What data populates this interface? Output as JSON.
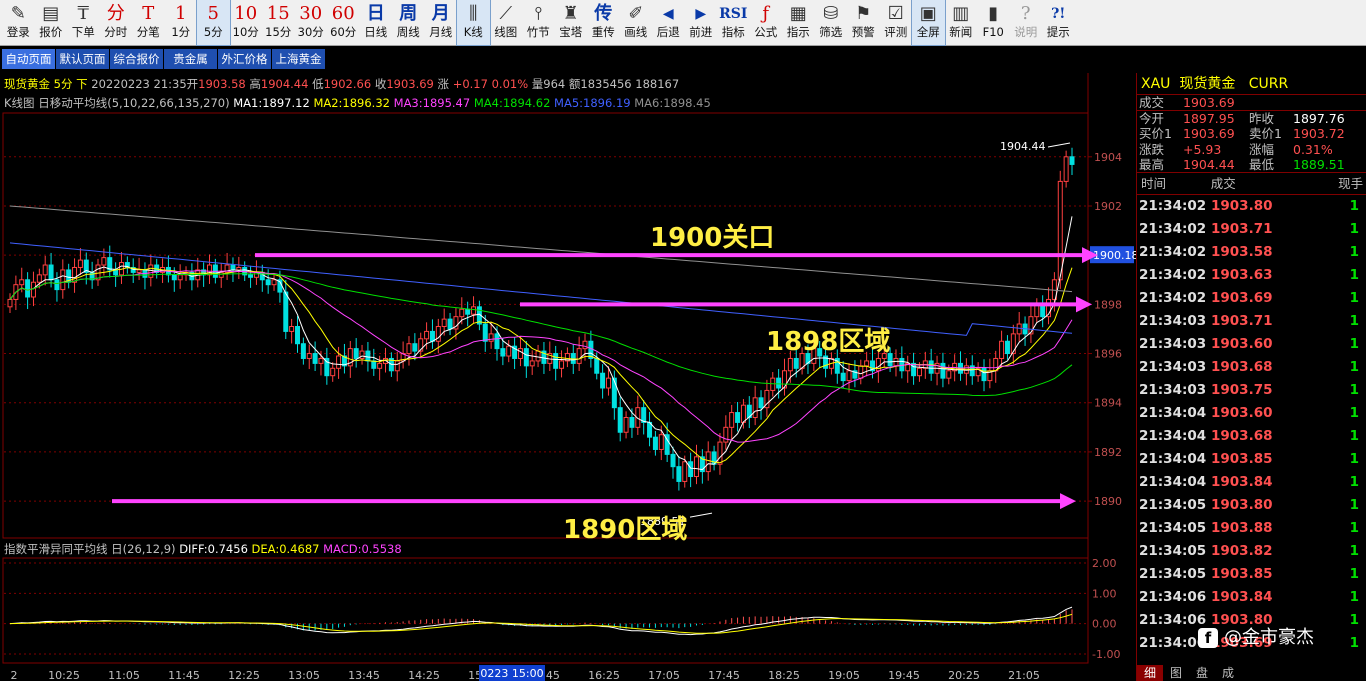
{
  "toolbar": [
    {
      "icon": "pencil-icon",
      "glyph": "✎",
      "label": "登录"
    },
    {
      "icon": "quote-icon",
      "glyph": "▤",
      "label": "报价"
    },
    {
      "icon": "order-icon",
      "glyph": "₸",
      "label": "下单"
    },
    {
      "icon": "intraday-icon",
      "glyph": "分",
      "label": "分时",
      "cls": "red"
    },
    {
      "icon": "tick-icon",
      "glyph": "T",
      "label": "分笔",
      "cls": "red"
    },
    {
      "icon": "period-1-icon",
      "glyph": "1",
      "label": "1分",
      "cls": "red"
    },
    {
      "icon": "period-5-icon",
      "glyph": "5",
      "label": "5分",
      "cls": "red",
      "active": true
    },
    {
      "icon": "period-10-icon",
      "glyph": "10",
      "label": "10分",
      "cls": "red"
    },
    {
      "icon": "period-15-icon",
      "glyph": "15",
      "label": "15分",
      "cls": "red"
    },
    {
      "icon": "period-30-icon",
      "glyph": "30",
      "label": "30分",
      "cls": "red"
    },
    {
      "icon": "period-60-icon",
      "glyph": "60",
      "label": "60分",
      "cls": "red"
    },
    {
      "icon": "daily-icon",
      "glyph": "日",
      "label": "日线",
      "cls": "blue"
    },
    {
      "icon": "weekly-icon",
      "glyph": "周",
      "label": "周线",
      "cls": "blue"
    },
    {
      "icon": "monthly-icon",
      "glyph": "月",
      "label": "月线",
      "cls": "blue"
    },
    {
      "icon": "candlestick-icon",
      "glyph": "⫼",
      "label": "K线",
      "active": true
    },
    {
      "icon": "line-chart-icon",
      "glyph": "⟋",
      "label": "线图"
    },
    {
      "icon": "bamboo-icon",
      "glyph": "⫯",
      "label": "竹节"
    },
    {
      "icon": "tower-icon",
      "glyph": "♜",
      "label": "宝塔"
    },
    {
      "icon": "rewind-icon",
      "glyph": "传",
      "label": "重传",
      "cls": "blue"
    },
    {
      "icon": "draw-icon",
      "glyph": "✐",
      "label": "画线"
    },
    {
      "icon": "back-icon",
      "glyph": "◀",
      "label": "后退",
      "cls": "blue small"
    },
    {
      "icon": "forward-icon",
      "glyph": "▶",
      "label": "前进",
      "cls": "blue small"
    },
    {
      "icon": "indicator-icon",
      "glyph": "RSI",
      "label": "指标",
      "cls": "blue small"
    },
    {
      "icon": "formula-icon",
      "glyph": "ƒ",
      "label": "公式",
      "cls": "red"
    },
    {
      "icon": "signal-icon",
      "glyph": "▦",
      "label": "指示"
    },
    {
      "icon": "filter-icon",
      "glyph": "⛁",
      "label": "筛选"
    },
    {
      "icon": "alert-icon",
      "glyph": "⚑",
      "label": "预警"
    },
    {
      "icon": "evaluate-icon",
      "glyph": "☑",
      "label": "评测"
    },
    {
      "icon": "fullscreen-icon",
      "glyph": "▣",
      "label": "全屏",
      "active": true
    },
    {
      "icon": "news-icon",
      "glyph": "▥",
      "label": "新闻"
    },
    {
      "icon": "f10-icon",
      "glyph": "▮",
      "label": "F10"
    },
    {
      "icon": "help-icon",
      "glyph": "?",
      "label": "说明",
      "disabled": true
    },
    {
      "icon": "hint-icon",
      "glyph": "?!",
      "label": "提示",
      "cls": "blue small"
    }
  ],
  "page_tabs": [
    "自动页面",
    "默认页面",
    "综合报价",
    "贵金属",
    "外汇价格",
    "上海黄金"
  ],
  "info_bar": {
    "name": "现货黄金",
    "period": "5分",
    "dir": "下",
    "date": "20220223",
    "time": "21:35",
    "open_label": "开",
    "open": "1903.58",
    "high_label": "高",
    "high": "1904.44",
    "low_label": "低",
    "low": "1902.66",
    "close_label": "收",
    "close": "1903.69",
    "chg_label": "涨",
    "chg": "+0.17",
    "pct": "0.01%",
    "vol_label": "量",
    "vol": "964",
    "amt_label": "额",
    "amt": "1835456",
    "oi": "188167"
  },
  "ma_bar": {
    "title": "K线图",
    "icon": "日",
    "name": "移动平均线",
    "params": "(5,10,22,66,135,270)",
    "ma1": "MA1:1897.12",
    "ma2": "MA2:1896.32",
    "ma3": "MA3:1895.47",
    "ma4": "MA4:1894.62",
    "ma5": "MA5:1896.19",
    "ma6": "MA6:1898.45"
  },
  "macd_bar": {
    "name": "指数平滑异同平均线",
    "icon": "日",
    "params": "(26,12,9)",
    "diff": "DIFF:0.7456",
    "dea": "DEA:0.4687",
    "macd": "MACD:0.5538"
  },
  "chart_data": [
    {
      "type": "candlestick",
      "title": "现货黄金 5分",
      "y_ticks": [
        "1904",
        "1902",
        "1900",
        "1898",
        "1896",
        "1894",
        "1892",
        "1890"
      ],
      "ylim": [
        1888.5,
        1905.7
      ],
      "x_ticks": [
        "2",
        "10:25",
        "11:05",
        "11:45",
        "12:25",
        "13:05",
        "13:45",
        "14:25",
        "15:05",
        "15:45",
        "16:25",
        "17:05",
        "17:45",
        "18:25",
        "19:05",
        "19:45",
        "20:25",
        "21:05"
      ],
      "cursor_label": "0223 15:00",
      "current_price_label": "1900.18",
      "max_label": "1904.44",
      "min_label": "1889.51",
      "closes": [
        1898.2,
        1898.8,
        1899.0,
        1898.3,
        1898.9,
        1899.2,
        1899.6,
        1899.0,
        1898.6,
        1899.4,
        1898.9,
        1899.5,
        1899.8,
        1899.3,
        1899.0,
        1899.6,
        1899.9,
        1899.4,
        1899.2,
        1899.7,
        1899.5,
        1899.3,
        1899.4,
        1899.1,
        1899.6,
        1899.3,
        1899.5,
        1899.2,
        1899.0,
        1899.2,
        1899.3,
        1899.0,
        1899.4,
        1899.2,
        1899.6,
        1899.1,
        1899.3,
        1899.6,
        1899.4,
        1899.5,
        1899.2,
        1899.1,
        1899.3,
        1899.0,
        1898.8,
        1899.0,
        1898.5,
        1896.9,
        1897.1,
        1896.4,
        1895.8,
        1896.0,
        1895.6,
        1895.8,
        1895.1,
        1895.4,
        1895.9,
        1895.5,
        1896.2,
        1895.8,
        1896.1,
        1895.7,
        1895.4,
        1895.6,
        1895.8,
        1895.3,
        1895.7,
        1896.0,
        1896.4,
        1896.1,
        1896.6,
        1896.9,
        1896.5,
        1897.1,
        1897.4,
        1897.0,
        1897.5,
        1897.8,
        1897.6,
        1897.9,
        1897.2,
        1896.5,
        1896.8,
        1896.2,
        1895.9,
        1896.3,
        1895.8,
        1896.2,
        1895.5,
        1895.7,
        1896.1,
        1895.6,
        1896.0,
        1895.4,
        1895.7,
        1896.0,
        1895.6,
        1896.2,
        1896.5,
        1895.8,
        1895.2,
        1894.6,
        1895.0,
        1893.8,
        1892.8,
        1893.4,
        1893.0,
        1893.8,
        1893.2,
        1892.6,
        1892.1,
        1892.7,
        1891.9,
        1891.4,
        1890.8,
        1891.6,
        1891.0,
        1891.8,
        1891.2,
        1892.0,
        1891.5,
        1892.4,
        1893.0,
        1893.6,
        1893.2,
        1893.9,
        1893.4,
        1894.2,
        1893.8,
        1894.5,
        1895.0,
        1894.6,
        1895.3,
        1895.8,
        1895.4,
        1896.0,
        1895.6,
        1896.2,
        1895.9,
        1895.4,
        1895.8,
        1895.2,
        1894.9,
        1895.3,
        1895.0,
        1895.5,
        1895.7,
        1895.3,
        1895.8,
        1896.0,
        1895.5,
        1895.8,
        1895.3,
        1895.6,
        1895.1,
        1895.4,
        1895.7,
        1895.2,
        1895.6,
        1895.0,
        1895.3,
        1895.6,
        1895.2,
        1895.5,
        1895.1,
        1895.4,
        1894.9,
        1895.3,
        1895.8,
        1896.5,
        1896.0,
        1896.8,
        1897.2,
        1896.8,
        1897.5,
        1898.0,
        1897.5,
        1898.2,
        1899.0,
        1903.0,
        1904.0,
        1903.69
      ],
      "series": [
        {
          "name": "MA1",
          "value": "1897.12",
          "color": "#ffffff"
        },
        {
          "name": "MA2",
          "value": "1896.32",
          "color": "#ffff00"
        },
        {
          "name": "MA3",
          "value": "1895.47",
          "color": "#ff44ff"
        },
        {
          "name": "MA4",
          "value": "1894.62",
          "color": "#00e000"
        },
        {
          "name": "MA5",
          "value": "1896.19",
          "color": "#4060ff"
        },
        {
          "name": "MA6",
          "value": "1898.45",
          "color": "#909090"
        }
      ],
      "annotations": [
        {
          "text": "1900关口",
          "y": 1900.0,
          "color": "#ff44ff"
        },
        {
          "text": "1898区域",
          "y": 1898.0,
          "color": "#ff44ff"
        },
        {
          "text": "1890区域",
          "y": 1890.0,
          "color": "#ff44ff"
        }
      ]
    },
    {
      "type": "macd",
      "y_ticks": [
        "2.00",
        "1.00",
        "0.00",
        "-1.00"
      ],
      "ylim": [
        -1.2,
        2.1
      ],
      "series": [
        {
          "name": "DIFF",
          "value": "0.7456",
          "color": "#ffffff"
        },
        {
          "name": "DEA",
          "value": "0.4687",
          "color": "#ffff00"
        },
        {
          "name": "MACD",
          "value": "0.5538",
          "color": "#ff44ff"
        }
      ]
    }
  ],
  "quote_panel": {
    "symbol": "XAU",
    "name": "现货黄金",
    "code": "CURR",
    "last_label": "成交",
    "last": "1903.69",
    "rows": [
      {
        "k": "今开",
        "v": "1897.95",
        "k2": "昨收",
        "v2": "1897.76",
        "v2c": "wht"
      },
      {
        "k": "买价1",
        "v": "1903.69",
        "k2": "卖价1",
        "v2": "1903.72",
        "v2c": "red"
      },
      {
        "k": "涨跌",
        "v": "+5.93",
        "k2": "涨幅",
        "v2": "0.31%",
        "v2c": "red"
      },
      {
        "k": "最高",
        "v": "1904.44",
        "k2": "最低",
        "v2": "1889.51",
        "v2c": "grn"
      }
    ]
  },
  "ticks_header": {
    "time": "时间",
    "price": "成交",
    "qty": "现手"
  },
  "ticks": [
    {
      "t": "21:34:02",
      "p": "1903.80",
      "q": "1"
    },
    {
      "t": "21:34:02",
      "p": "1903.71",
      "q": "1"
    },
    {
      "t": "21:34:02",
      "p": "1903.58",
      "q": "1"
    },
    {
      "t": "21:34:02",
      "p": "1903.63",
      "q": "1"
    },
    {
      "t": "21:34:02",
      "p": "1903.69",
      "q": "1"
    },
    {
      "t": "21:34:03",
      "p": "1903.71",
      "q": "1"
    },
    {
      "t": "21:34:03",
      "p": "1903.60",
      "q": "1"
    },
    {
      "t": "21:34:03",
      "p": "1903.68",
      "q": "1"
    },
    {
      "t": "21:34:03",
      "p": "1903.75",
      "q": "1"
    },
    {
      "t": "21:34:04",
      "p": "1903.60",
      "q": "1"
    },
    {
      "t": "21:34:04",
      "p": "1903.68",
      "q": "1"
    },
    {
      "t": "21:34:04",
      "p": "1903.85",
      "q": "1"
    },
    {
      "t": "21:34:04",
      "p": "1903.84",
      "q": "1"
    },
    {
      "t": "21:34:05",
      "p": "1903.80",
      "q": "1"
    },
    {
      "t": "21:34:05",
      "p": "1903.88",
      "q": "1"
    },
    {
      "t": "21:34:05",
      "p": "1903.82",
      "q": "1"
    },
    {
      "t": "21:34:05",
      "p": "1903.85",
      "q": "1"
    },
    {
      "t": "21:34:06",
      "p": "1903.84",
      "q": "1"
    },
    {
      "t": "21:34:06",
      "p": "1903.80",
      "q": "1"
    },
    {
      "t": "21:34:06",
      "p": "1903.69",
      "q": "1"
    }
  ],
  "panel_tabs": [
    "细",
    "图",
    "盘",
    "成"
  ],
  "watermark": "@金市豪杰"
}
